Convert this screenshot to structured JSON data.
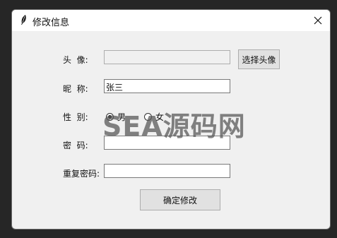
{
  "window": {
    "title": "修改信息"
  },
  "form": {
    "avatar_label": "头  像:",
    "avatar_value": "",
    "choose_avatar_button": "选择头像",
    "nickname_label": "昵  称:",
    "nickname_value": "张三",
    "gender_label": "性  别:",
    "gender_options": [
      "男",
      "女"
    ],
    "gender_selected": "男",
    "password_label": "密  码:",
    "password_value": "",
    "confirm_password_label": "重复密码:",
    "confirm_password_value": "",
    "submit_button": "确定修改"
  },
  "watermark": "SEA源码网"
}
